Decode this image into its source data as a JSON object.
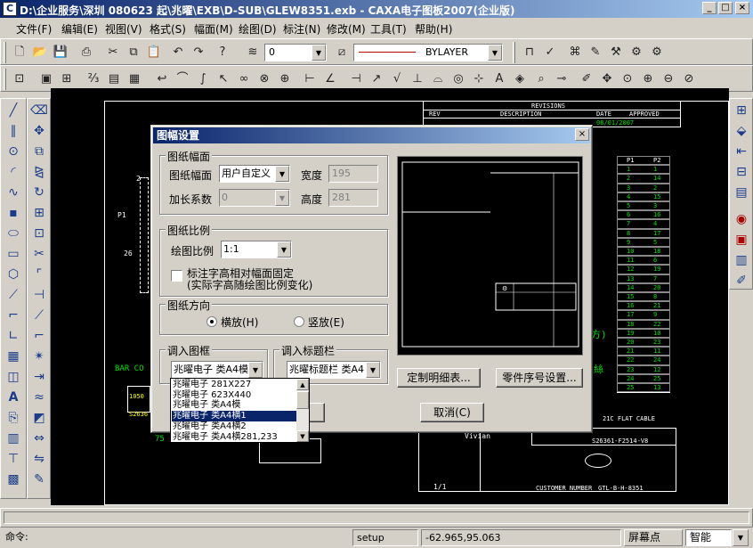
{
  "window": {
    "title": "D:\\企业服务\\深圳 080623 起\\兆曜\\EXB\\D-SUB\\GLEW8351.exb - CAXA电子图板2007(企业版)",
    "minimize": "_",
    "maximize": "□",
    "close": "×"
  },
  "menu": [
    "文件(F)",
    "编辑(E)",
    "视图(V)",
    "格式(S)",
    "幅面(M)",
    "绘图(D)",
    "标注(N)",
    "修改(M)",
    "工具(T)",
    "帮助(H)"
  ],
  "toolbar": {
    "layer_value": "0",
    "linetype_value": "BYLAYER"
  },
  "canvas": {
    "revisions_title": "REVISIONS",
    "rev_headers": [
      "REV",
      "DESCRIPTION",
      "DATE",
      "APPROVED"
    ],
    "rev_row_date": "08/01/2007",
    "table_headers": [
      "P1",
      "P2"
    ],
    "table_rows": [
      [
        "1",
        "1"
      ],
      [
        "2",
        "14"
      ],
      [
        "3",
        "2"
      ],
      [
        "4",
        "15"
      ],
      [
        "5",
        "3"
      ],
      [
        "6",
        "16"
      ],
      [
        "7",
        "4"
      ],
      [
        "8",
        "17"
      ],
      [
        "9",
        "5"
      ],
      [
        "10",
        "18"
      ],
      [
        "11",
        "6"
      ],
      [
        "12",
        "19"
      ],
      [
        "13",
        "7"
      ],
      [
        "14",
        "20"
      ],
      [
        "15",
        "8"
      ],
      [
        "16",
        "21"
      ],
      [
        "17",
        "9"
      ],
      [
        "18",
        "22"
      ],
      [
        "19",
        "10"
      ],
      [
        "20",
        "23"
      ],
      [
        "21",
        "11"
      ],
      [
        "22",
        "24"
      ],
      [
        "23",
        "12"
      ],
      [
        "24",
        "25"
      ],
      [
        "25",
        "13"
      ]
    ],
    "label_p1": "P1",
    "label_2": "2",
    "label_26": "26",
    "bar_code_text": "BAR CO",
    "barcode_num_1": "1050",
    "barcode_num_2": "S2636",
    "dim_75": "75",
    "green_label_1": "方)",
    "green_label_2": "絲",
    "part_no": "S26361-F2514-V8",
    "product": "21C FLAT CABLE",
    "drawer": "Vivian",
    "scale": "1/1",
    "model_no": "GTL-B-H-8351",
    "customer": "CUSTOMER NUMBER"
  },
  "dialog": {
    "title": "图幅设置",
    "close": "×",
    "paper_group": "图纸幅面",
    "paper_label": "图纸幅面",
    "paper_value": "用户自定义",
    "width_label": "宽度",
    "width_value": "195",
    "extend_label": "加长系数",
    "extend_value": "0",
    "height_label": "高度",
    "height_value": "281",
    "scale_group": "图纸比例",
    "scale_label": "绘图比例",
    "scale_value": "1:1",
    "fixed_line1": "标注字高相对幅面固定",
    "fixed_line2": "(实际字高随绘图比例变化)",
    "orient_group": "图纸方向",
    "landscape": "横放(H)",
    "portrait": "竖放(E)",
    "frame_group": "调入图框",
    "frame_value": "兆曜电子 类A4模",
    "titleblock_group": "调入标题栏",
    "titleblock_value": "兆曜标题栏 类A4",
    "bom_button": "定制明细表...",
    "partno_button": "零件序号设置...",
    "cancel_button": "取消(C)"
  },
  "frame_options": [
    "兆曜电子 281X227",
    "兆曜电子 623X440",
    "兆曜电子 类A4模",
    "兆曜电子 类A4横1",
    "兆曜电子 类A4横2",
    "兆曜电子 类A4横281,233"
  ],
  "frame_selected_index": 3,
  "command": {
    "prompt": "命令:"
  },
  "status": {
    "mode": "setup",
    "coords": "-62.965,95.063",
    "screen_point": "屏幕点",
    "snap": "智能"
  }
}
